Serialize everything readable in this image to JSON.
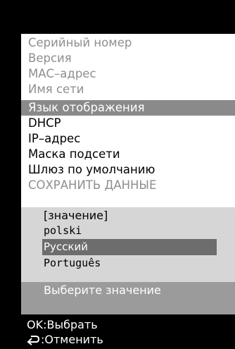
{
  "menu": {
    "items": [
      {
        "label": "Серийный номер",
        "state": "dim"
      },
      {
        "label": "Версия",
        "state": "dim"
      },
      {
        "label": "МАС–адрес",
        "state": "dim"
      },
      {
        "label": "Имя сети",
        "state": "dim"
      },
      {
        "label": "Язык отображения",
        "state": "selected"
      },
      {
        "label": "DHCP",
        "state": "active"
      },
      {
        "label": "IP–адрес",
        "state": "active"
      },
      {
        "label": "Маска подсети",
        "state": "active"
      },
      {
        "label": "Шлюз по умолчанию",
        "state": "active"
      },
      {
        "label": "СОХРАНИТЬ ДАННЫЕ",
        "state": "dim"
      }
    ]
  },
  "dialog": {
    "header": "[значение]",
    "options": [
      "polski",
      "Русский",
      "Português"
    ],
    "selected_option": "Русский",
    "hint": "Выберите значение"
  },
  "footer": {
    "ok_label": "OK:Выбрать",
    "back_label": ":Отменить",
    "back_icon": "return-arrow-icon"
  }
}
